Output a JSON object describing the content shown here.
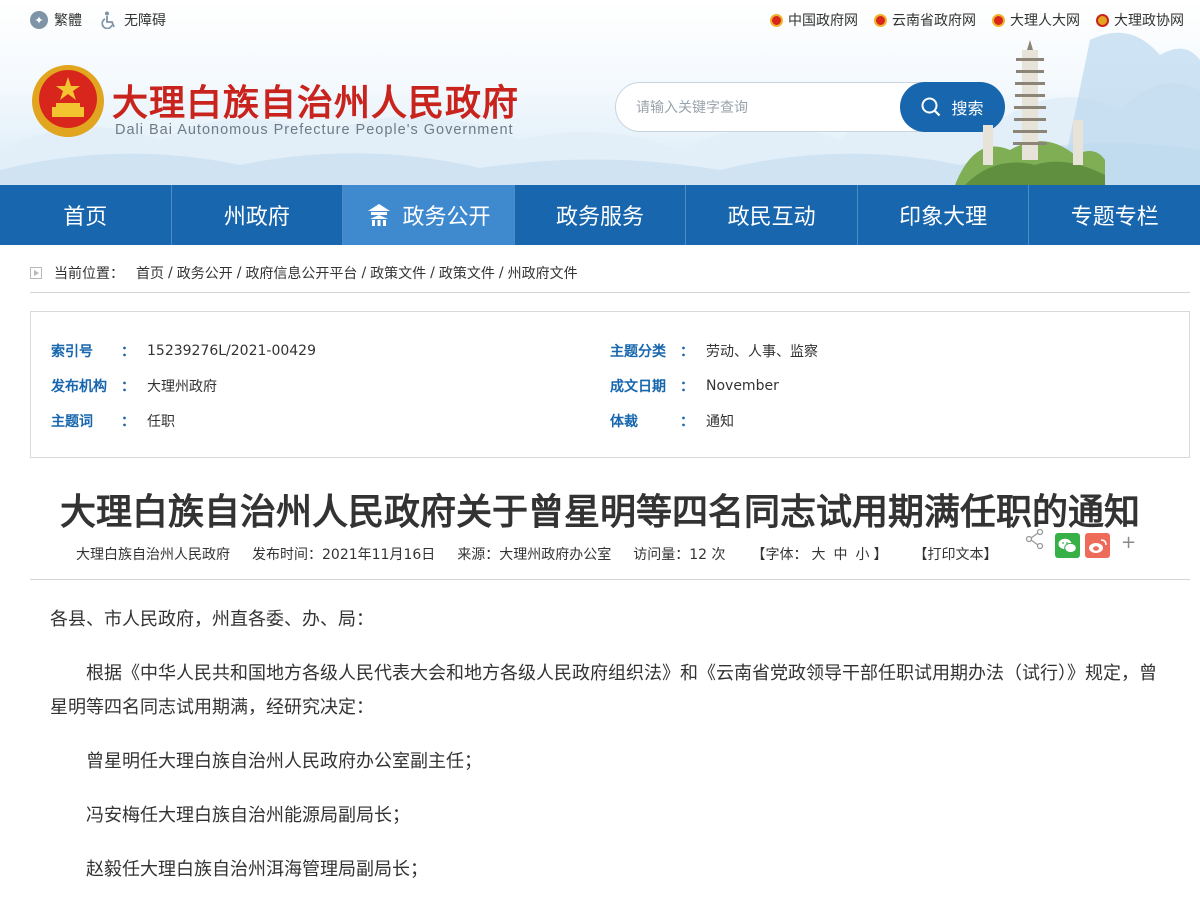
{
  "topbar": {
    "traditional_label": "繁體",
    "accessibility_label": "无障碍",
    "links": [
      "中国政府网",
      "云南省政府网",
      "大理人大网",
      "大理政协网"
    ]
  },
  "header": {
    "title": "大理白族自治州人民政府",
    "subtitle": "Dali Bai Autonomous Prefecture People's Government"
  },
  "search": {
    "placeholder": "请输入关键字查询",
    "button_label": "搜索"
  },
  "nav": {
    "items": [
      "首页",
      "州政府",
      "政务公开",
      "政务服务",
      "政民互动",
      "印象大理",
      "专题专栏"
    ],
    "active_index": 2
  },
  "breadcrumb": {
    "label": "当前位置：",
    "items": [
      "首页",
      "政务公开",
      "政府信息公开平台",
      "政策文件",
      "政策文件",
      "州政府文件"
    ]
  },
  "meta": {
    "index_no": {
      "key": "索引号",
      "value": "15239276L/2021-00429"
    },
    "publisher": {
      "key": "发布机构",
      "value": "大理州政府"
    },
    "keywords": {
      "key": "主题词",
      "value": "任职"
    },
    "category": {
      "key": "主题分类",
      "value": "劳动、人事、监察"
    },
    "date": {
      "key": "成文日期",
      "value": "November"
    },
    "genre": {
      "key": "体裁",
      "value": "通知"
    },
    "colon": "："
  },
  "article": {
    "title": "大理白族自治州人民政府关于曾星明等四名同志试用期满任职的通知",
    "author": "大理白族自治州人民政府",
    "publish_time": "发布时间：2021年11月16日",
    "source": "来源：大理州政府办公室",
    "visits": "访问量：12 次",
    "font_label": "【字体：",
    "font_large": "大",
    "font_medium": "中",
    "font_small": "小",
    "font_close": "】",
    "print_label": "【打印文本】",
    "share_plus": "+",
    "paragraphs": [
      "各县、市人民政府，州直各委、办、局：",
      "根据《中华人民共和国地方各级人民代表大会和地方各级人民政府组织法》和《云南省党政领导干部任职试用期办法（试行）》规定，曾星明等四名同志试用期满，经研究决定：",
      "曾星明任大理白族自治州人民政府办公室副主任；",
      "冯安梅任大理白族自治州能源局副局长；",
      "赵毅任大理白族自治州洱海管理局副局长；"
    ]
  },
  "colors": {
    "primary": "#1766ae",
    "nav_active": "#3f89cf",
    "title_red": "#c9231d"
  }
}
